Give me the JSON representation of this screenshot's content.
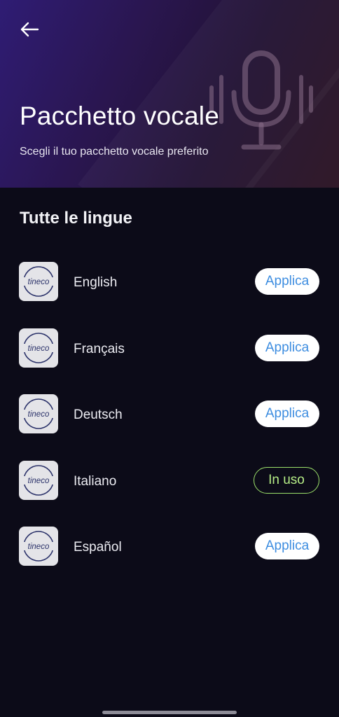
{
  "header": {
    "title": "Pacchetto vocale",
    "subtitle": "Scegli il tuo pacchetto vocale preferito",
    "back_icon": "arrow-left-icon",
    "art_icon": "microphone-icon"
  },
  "section": {
    "title": "Tutte le lingue"
  },
  "languages": [
    {
      "name": "English",
      "logo_text": "tineco",
      "action": "Applica",
      "in_use": false
    },
    {
      "name": "Français",
      "logo_text": "tineco",
      "action": "Applica",
      "in_use": false
    },
    {
      "name": "Deutsch",
      "logo_text": "tineco",
      "action": "Applica",
      "in_use": false
    },
    {
      "name": "Italiano",
      "logo_text": "tineco",
      "action": "In uso",
      "in_use": true
    },
    {
      "name": "Español",
      "logo_text": "tineco",
      "action": "Applica",
      "in_use": false
    }
  ],
  "colors": {
    "background": "#0c0b18",
    "apply_text": "#3d8de0",
    "in_use_accent": "#9be06a"
  }
}
